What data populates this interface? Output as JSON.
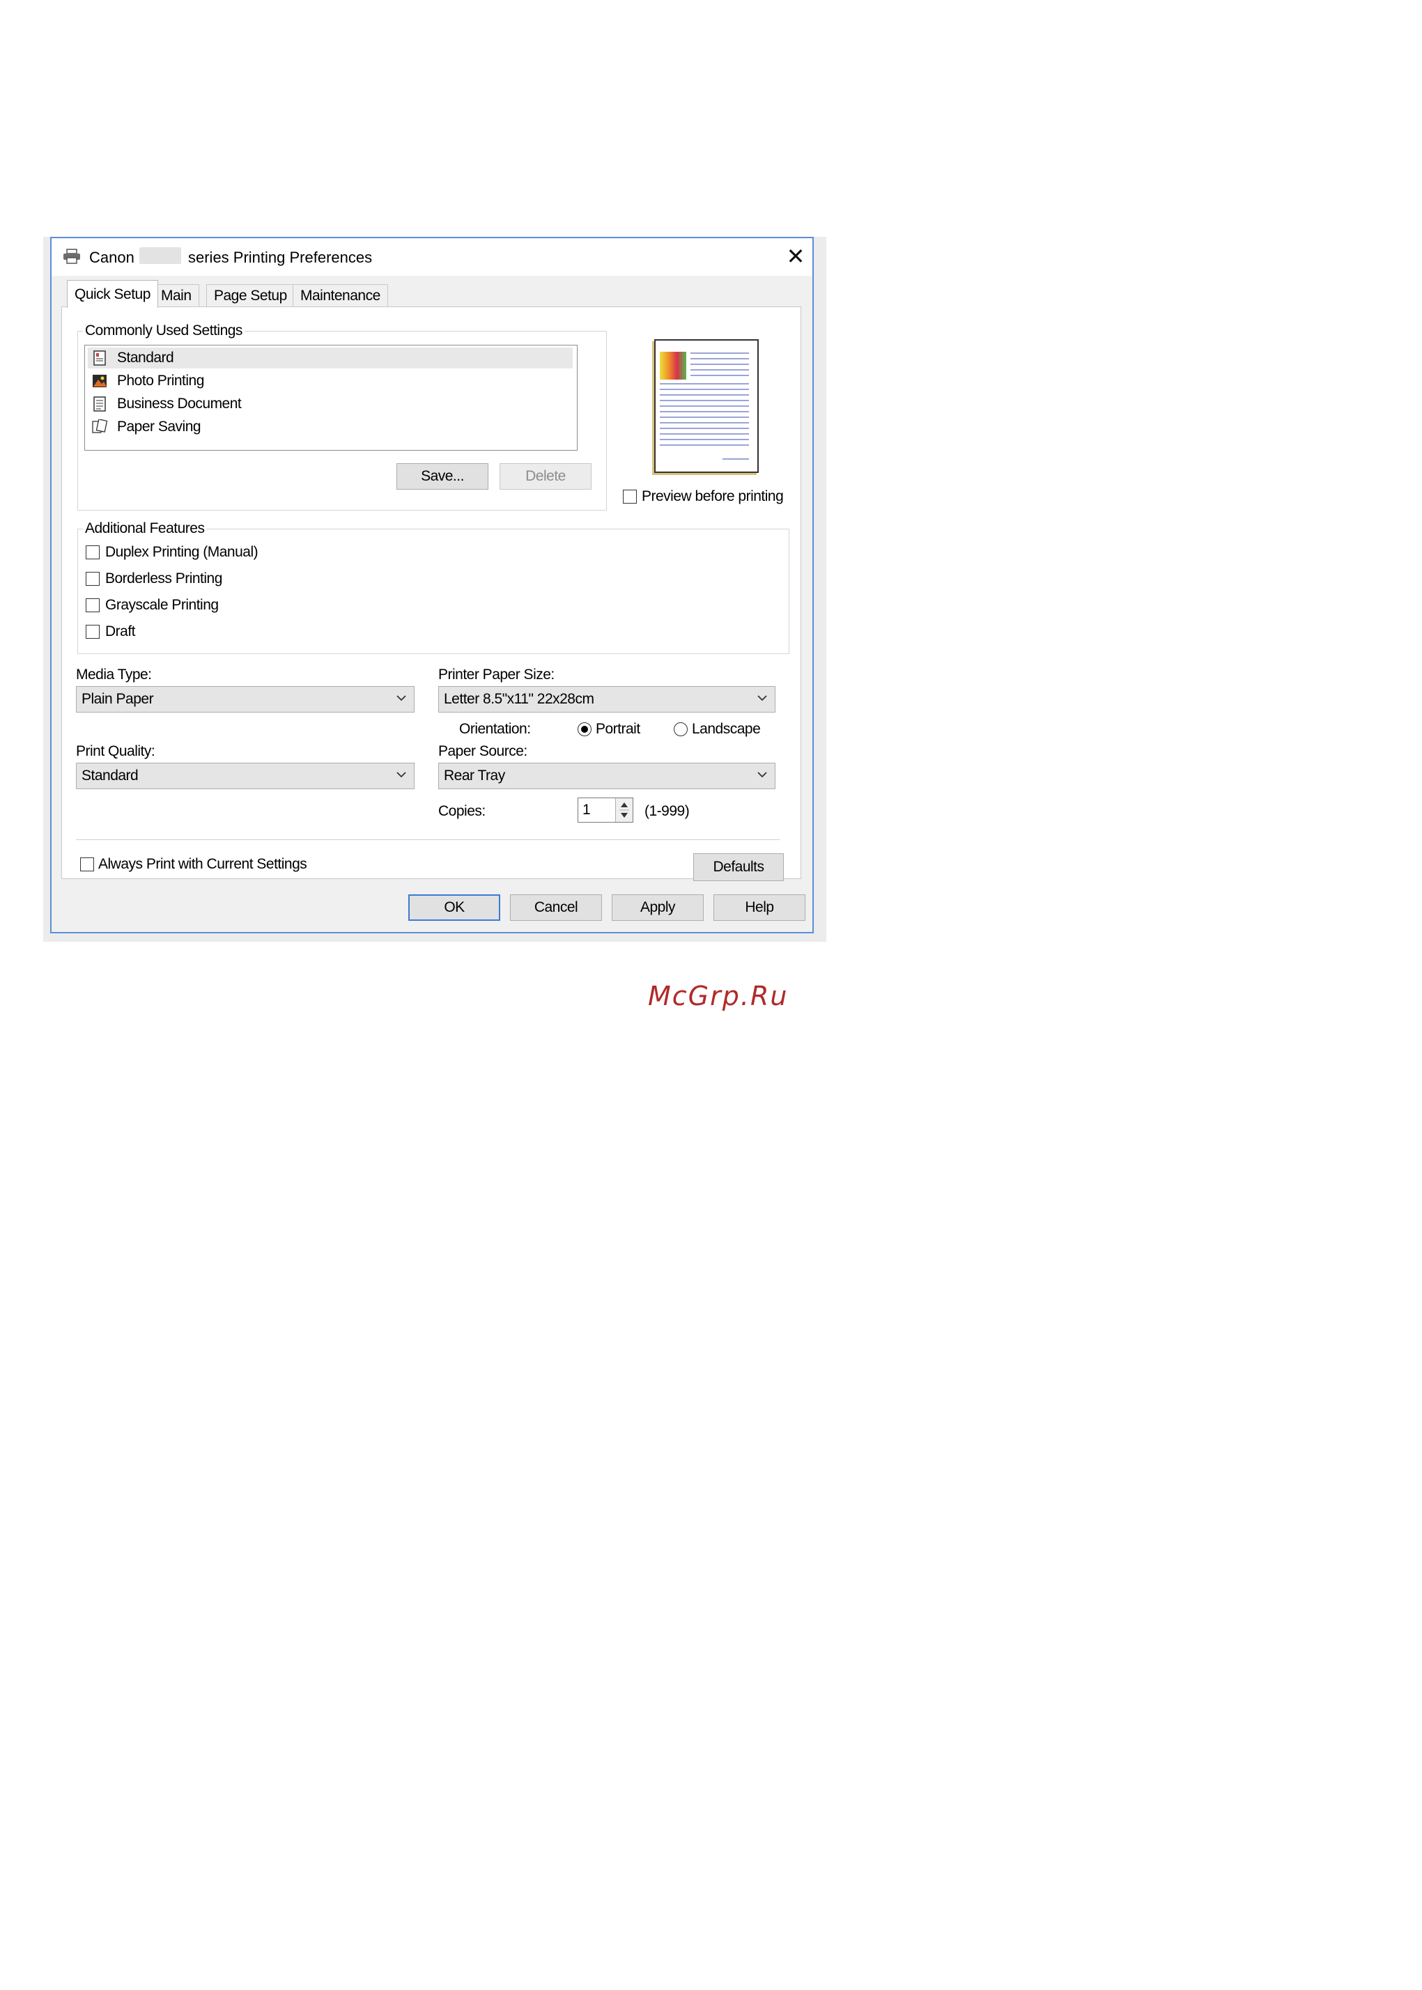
{
  "window": {
    "title_brand": "Canon",
    "title_suffix": "series Printing Preferences"
  },
  "tabs": [
    {
      "label": "Quick Setup"
    },
    {
      "label": "Main"
    },
    {
      "label": "Page Setup"
    },
    {
      "label": "Maintenance"
    }
  ],
  "commonly_used": {
    "group_label": "Commonly Used Settings",
    "items": [
      {
        "label": "Standard",
        "icon": "standard-doc-icon",
        "selected": true
      },
      {
        "label": "Photo Printing",
        "icon": "photo-icon"
      },
      {
        "label": "Business Document",
        "icon": "business-document-icon"
      },
      {
        "label": "Paper Saving",
        "icon": "paper-saving-icon"
      }
    ],
    "save_label": "Save...",
    "delete_label": "Delete"
  },
  "preview": {
    "checkbox_label": "Preview before printing",
    "checked": false
  },
  "additional_features": {
    "group_label": "Additional Features",
    "items": [
      {
        "label": "Duplex Printing (Manual)",
        "checked": false
      },
      {
        "label": "Borderless Printing",
        "checked": false
      },
      {
        "label": "Grayscale Printing",
        "checked": false
      },
      {
        "label": "Draft",
        "checked": false
      }
    ]
  },
  "media_type": {
    "label": "Media Type:",
    "value": "Plain Paper"
  },
  "paper_size": {
    "label": "Printer Paper Size:",
    "value": "Letter 8.5\"x11\" 22x28cm"
  },
  "orientation": {
    "label": "Orientation:",
    "portrait": "Portrait",
    "landscape": "Landscape",
    "selected": "Portrait"
  },
  "print_quality": {
    "label": "Print Quality:",
    "value": "Standard"
  },
  "paper_source": {
    "label": "Paper Source:",
    "value": "Rear Tray"
  },
  "copies": {
    "label": "Copies:",
    "value": "1",
    "range": "(1-999)"
  },
  "always_print": {
    "label": "Always Print with Current Settings",
    "checked": false
  },
  "defaults_label": "Defaults",
  "footer": {
    "ok": "OK",
    "cancel": "Cancel",
    "apply": "Apply",
    "help": "Help"
  },
  "watermark": "McGrp.Ru",
  "colors": {
    "window_border": "#5b8fd6",
    "default_button_border": "#3d7bd4",
    "watermark": "#b12a2a"
  }
}
